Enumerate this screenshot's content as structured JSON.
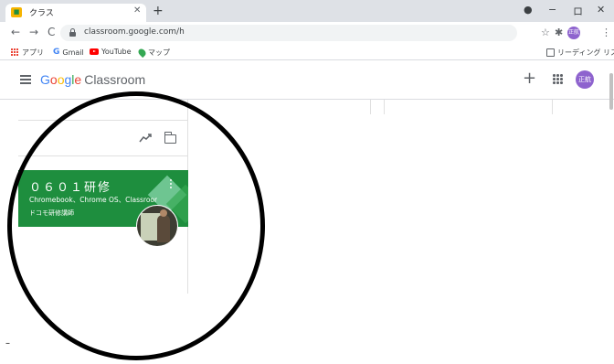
{
  "browser": {
    "tab": {
      "title": "クラス",
      "favicon_text": "■"
    },
    "new_tab_label": "+",
    "window_controls": {
      "chrome_icon": "●",
      "minimize": "−",
      "restore": "ロ",
      "close": "✕"
    },
    "toolbar": {
      "back": "←",
      "forward": "→",
      "reload": "C",
      "url": "classroom.google.com/h",
      "star": "☆",
      "extensions": "✱",
      "profile_initials": "正航",
      "more": "⋮"
    },
    "bookmarks": {
      "apps": "アプリ",
      "gmail": "Gmail",
      "youtube": "YouTube",
      "maps": "マップ",
      "reading_list": "リーディング リスト"
    }
  },
  "classroom": {
    "header": {
      "logo_letters": [
        "G",
        "o",
        "o",
        "g",
        "l",
        "e"
      ],
      "product": "Classroom",
      "add_label": "+",
      "avatar_initials": "正航"
    },
    "course_card": {
      "title": "０６０１研修",
      "section": "Chromebook、Chrome OS、Classroom",
      "owner": "ドコモ研修講師",
      "more": "⋮"
    }
  },
  "annotation": {
    "mark": "–"
  }
}
